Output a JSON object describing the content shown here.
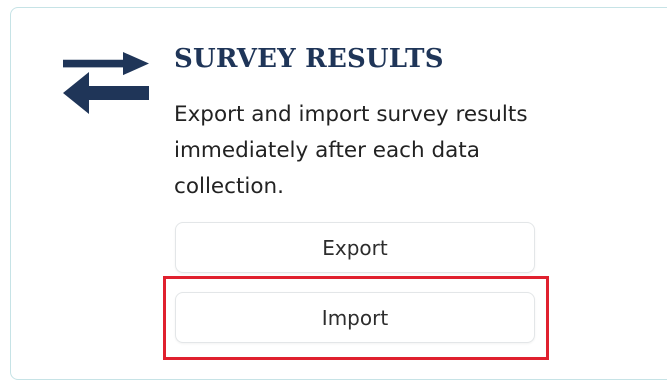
{
  "card": {
    "icon": "swap-arrows-icon",
    "title": "SURVEY RESULTS",
    "description": "Export and import survey results immediately after each data collection.",
    "buttons": {
      "export_label": "Export",
      "import_label": "Import"
    },
    "highlight_target": "import-button"
  },
  "colors": {
    "title": "#1f3558",
    "icon": "#1f3558",
    "card_border": "#c6e3e6",
    "highlight": "#e0202e"
  }
}
